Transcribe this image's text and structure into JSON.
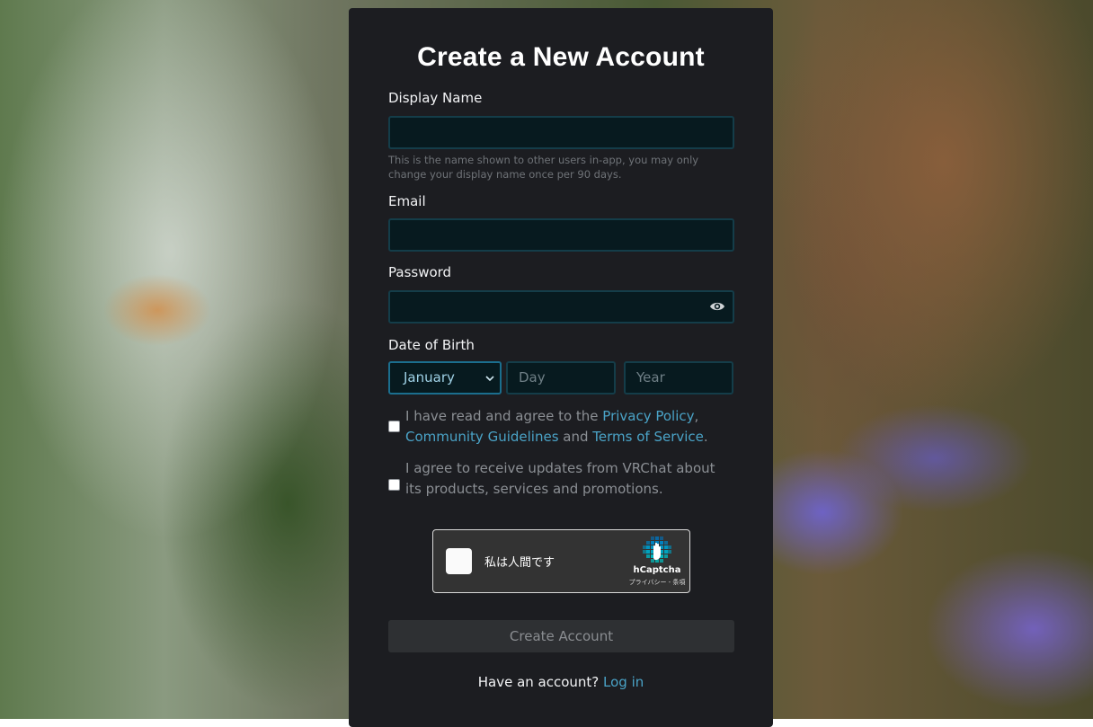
{
  "form": {
    "title": "Create a New Account",
    "display_name": {
      "label": "Display Name",
      "value": "",
      "hint": "This is the name shown to other users in-app, you may only change your display name once per 90 days."
    },
    "email": {
      "label": "Email",
      "value": ""
    },
    "password": {
      "label": "Password",
      "value": "",
      "toggle_icon": "eye-icon"
    },
    "dob": {
      "label": "Date of Birth",
      "month": "January",
      "day_placeholder": "Day",
      "year_placeholder": "Year"
    },
    "terms": {
      "prefix": "I have read and agree to the ",
      "privacy": "Privacy Policy",
      "comma": ",",
      "guidelines": "Community Guidelines",
      "and": " and ",
      "tos": "Terms of Service",
      "period": ".",
      "checked": false
    },
    "updates": {
      "text": "I agree to receive updates from VRChat about its products, services and promotions.",
      "checked": false
    },
    "captcha": {
      "prompt": "私は人間です",
      "brand": "hCaptcha",
      "links": "プライバシー - 条項"
    },
    "submit_label": "Create Account",
    "footer": {
      "question": "Have an account?",
      "login_label": "Log in"
    }
  },
  "colors": {
    "card_bg": "#1c1d21",
    "input_bg": "#071a1f",
    "input_border": "#143d49",
    "link": "#4aa3c7",
    "button_bg": "#2e3033"
  }
}
